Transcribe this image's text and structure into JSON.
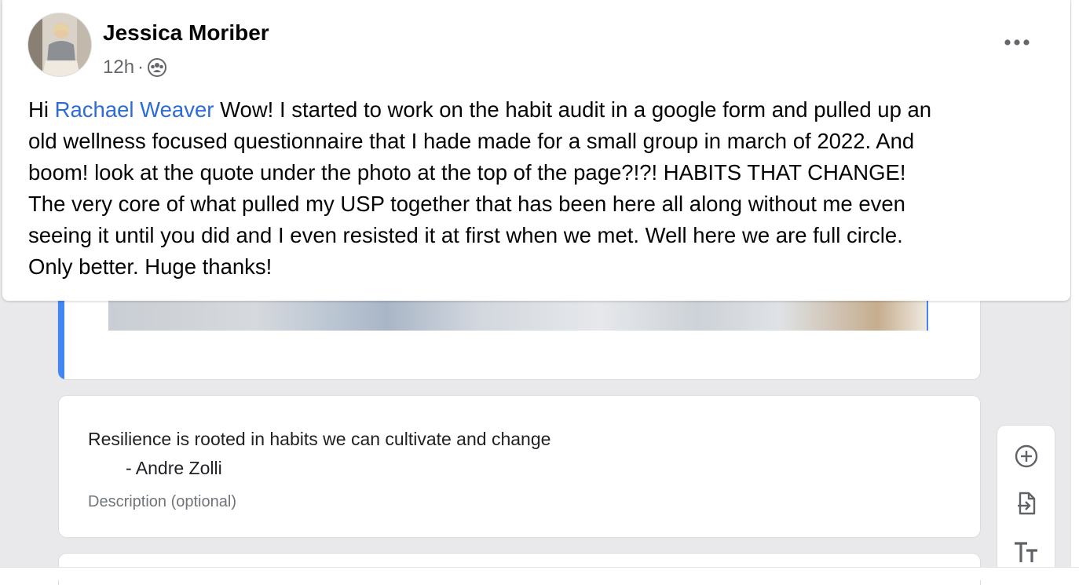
{
  "post": {
    "author": "Jessica Moriber",
    "timestamp": "12h",
    "separator": "·",
    "privacy_icon": "group-icon",
    "more_icon": "more-icon",
    "greeting": "Hi",
    "mention": "Rachael Weaver",
    "lines": [
      "Wow! I started to work on the habit audit in a google form and pulled up an",
      "old wellness focused questionnaire that I hade made for a small group in march of 2022. And",
      "boom! look at the quote under the photo at the top of the page?!?! HABITS THAT CHANGE!",
      "The very core of what pulled my USP together that has been here all along without me even",
      "seeing it until you did and I even resisted it at first when we met. Well here we are full circle.",
      "Only better. Huge thanks!"
    ]
  },
  "form": {
    "quote_line1": "Resilience is rooted in habits we can cultivate and change",
    "quote_line2": "- Andre Zolli",
    "description_placeholder": "Description (optional)",
    "toolbar": [
      {
        "icon": "add-question-icon"
      },
      {
        "icon": "import-questions-icon"
      },
      {
        "icon": "add-title-icon"
      }
    ],
    "colors": {
      "accent": "#4285f4",
      "mention": "#2d6bd6"
    }
  }
}
